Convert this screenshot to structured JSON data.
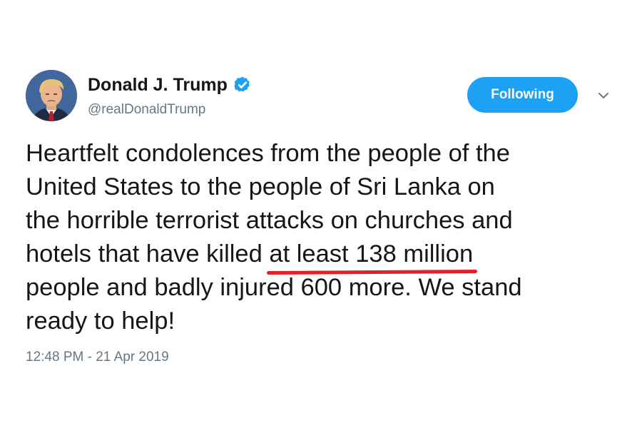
{
  "user": {
    "display_name": "Donald J. Trump",
    "handle": "@realDonaldTrump",
    "verified": true,
    "avatar_icon": "profile-photo"
  },
  "follow_button": {
    "label": "Following",
    "color": "#1da1f2"
  },
  "menu_icon": "chevron-down-icon",
  "tweet": {
    "line1": "Heartfelt condolences from the people of the",
    "line2": "United States to the people of Sri Lanka on",
    "line3": "the horrible terrorist attacks on churches and",
    "line4_before": "hotels that have killed ",
    "line4_highlight": "at least 138 million",
    "line5": "people and badly injured 600 more. We stand",
    "line6": "ready to help!"
  },
  "highlight_color": "#e0202a",
  "timestamp": "12:48 PM - 21 Apr 2019"
}
